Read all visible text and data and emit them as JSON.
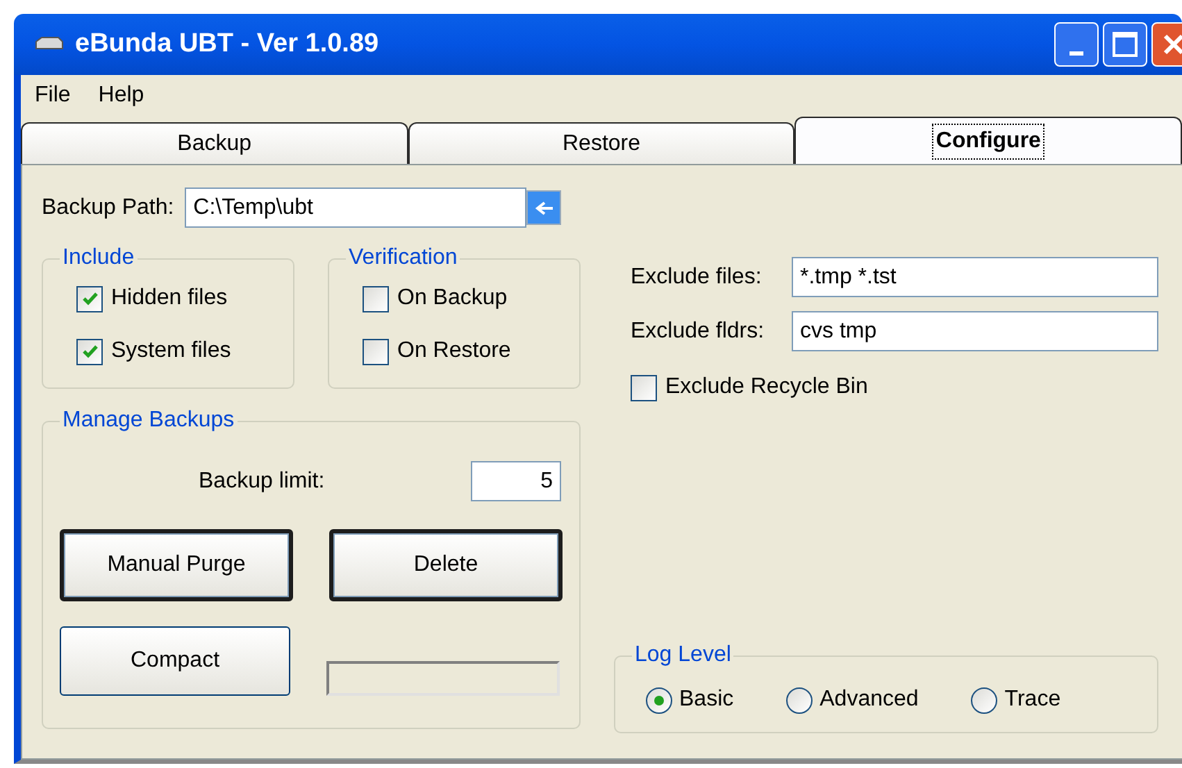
{
  "window": {
    "title": "eBunda UBT - Ver 1.0.89"
  },
  "menu": [
    "File",
    "Help"
  ],
  "tabs": [
    {
      "label": "Backup",
      "selected": false
    },
    {
      "label": "Restore",
      "selected": false
    },
    {
      "label": "Configure",
      "selected": true
    }
  ],
  "backup_path": {
    "label": "Backup Path:",
    "value": "C:\\Temp\\ubt"
  },
  "include": {
    "title": "Include",
    "options": [
      {
        "label": "Hidden files",
        "checked": true
      },
      {
        "label": "System files",
        "checked": true
      }
    ]
  },
  "verification": {
    "title": "Verification",
    "options": [
      {
        "label": "On Backup",
        "checked": false
      },
      {
        "label": "On Restore",
        "checked": false
      }
    ]
  },
  "manage_backups": {
    "title": "Manage Backups",
    "limit_label": "Backup limit:",
    "limit_value": "5",
    "buttons": [
      {
        "label": "Manual Purge",
        "bold_border": true
      },
      {
        "label": "Delete",
        "bold_border": true
      },
      {
        "label": "Compact",
        "bold_border": false
      }
    ]
  },
  "exclude_files": {
    "label": "Exclude files:",
    "value": "*.tmp *.tst"
  },
  "exclude_folders": {
    "label": "Exclude fldrs:",
    "value": "cvs tmp"
  },
  "exclude_recycle_bin": {
    "label": "Exclude Recycle Bin",
    "checked": false
  },
  "log_level": {
    "title": "Log Level",
    "options": [
      {
        "label": "Basic",
        "selected": true
      },
      {
        "label": "Advanced",
        "selected": false
      },
      {
        "label": "Trace",
        "selected": false
      }
    ]
  }
}
